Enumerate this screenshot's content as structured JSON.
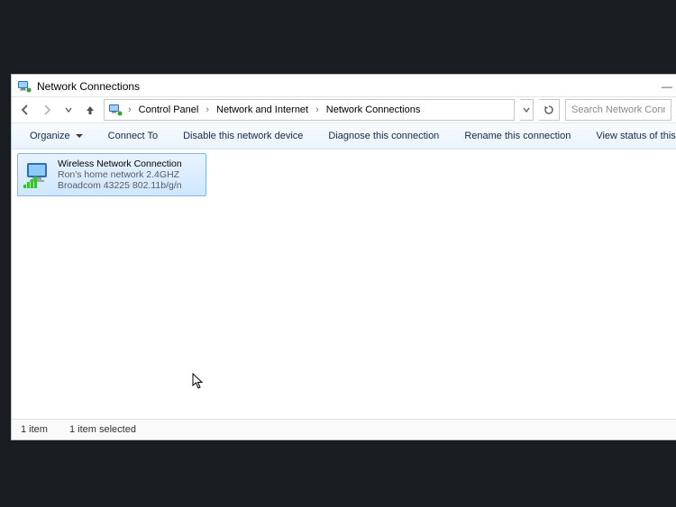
{
  "window": {
    "title": "Network Connections"
  },
  "breadcrumb": {
    "seg1": "Control Panel",
    "seg2": "Network and Internet",
    "seg3": "Network Connections"
  },
  "search": {
    "placeholder": "Search Network Connectio"
  },
  "toolbar": {
    "organize": "Organize",
    "connect_to": "Connect To",
    "disable": "Disable this network device",
    "diagnose": "Diagnose this connection",
    "rename": "Rename this connection",
    "view_status": "View status of this connection",
    "overflow": "»"
  },
  "connection": {
    "name": "Wireless Network Connection",
    "ssid": "Ron's home network 2.4GHZ",
    "adapter": "Broadcom 43225 802.11b/g/n"
  },
  "status": {
    "count": "1 item",
    "selected": "1 item selected"
  }
}
